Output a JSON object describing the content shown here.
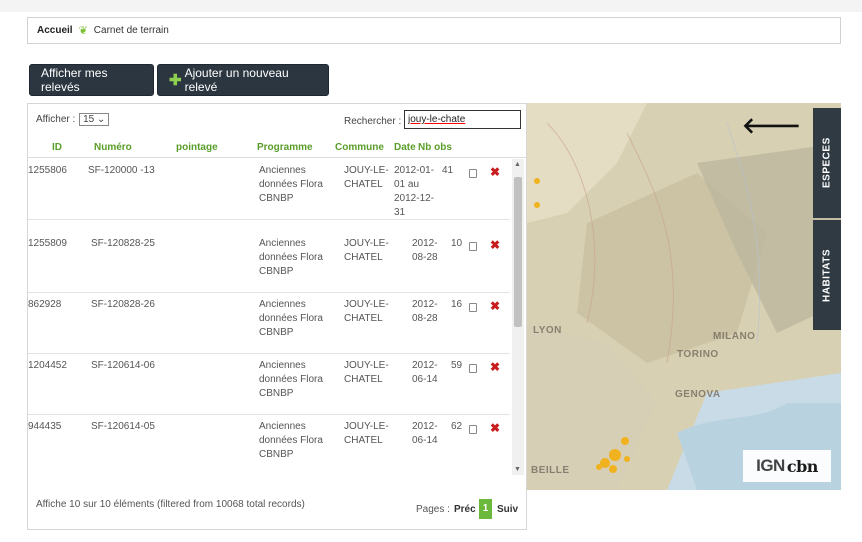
{
  "breadcrumb": {
    "home": "Accueil",
    "page": "Carnet de terrain"
  },
  "buttons": {
    "my_records": "Afficher mes relevés",
    "add_record": "Ajouter un nouveau relevé"
  },
  "controls": {
    "show_label": "Afficher :",
    "page_size": "15",
    "search_label": "Rechercher :",
    "search_value": "jouy-le-chate"
  },
  "columns": [
    "ID",
    "Numéro",
    "pointage",
    "Programme",
    "Commune",
    "Date",
    "Nb obs"
  ],
  "rows": [
    {
      "id": "1255806",
      "numero": "SF-120000 -13",
      "programme": [
        "Anciennes",
        "données Flora",
        "CBNBP"
      ],
      "commune": [
        "JOUY-LE-",
        "CHATEL"
      ],
      "date": [
        "2012-01-",
        "01 au",
        "2012-12-",
        "31"
      ],
      "nb_obs": "41"
    },
    {
      "id": "1255809",
      "numero": "SF-120828-25",
      "programme": [
        "Anciennes",
        "données Flora",
        "CBNBP"
      ],
      "commune": [
        "JOUY-LE-",
        "CHATEL"
      ],
      "date": [
        "2012-",
        "08-28"
      ],
      "nb_obs": "10"
    },
    {
      "id": "862928",
      "numero": "SF-120828-26",
      "programme": [
        "Anciennes",
        "données Flora",
        "CBNBP"
      ],
      "commune": [
        "JOUY-LE-",
        "CHATEL"
      ],
      "date": [
        "2012-",
        "08-28"
      ],
      "nb_obs": "16"
    },
    {
      "id": "1204452",
      "numero": "SF-120614-06",
      "programme": [
        "Anciennes",
        "données Flora",
        "CBNBP"
      ],
      "commune": [
        "JOUY-LE-",
        "CHATEL"
      ],
      "date": [
        "2012-",
        "06-14"
      ],
      "nb_obs": "59"
    },
    {
      "id": "944435",
      "numero": "SF-120614-05",
      "programme": [
        "Anciennes",
        "données Flora",
        "CBNBP"
      ],
      "commune": [
        "JOUY-LE-",
        "CHATEL"
      ],
      "date": [
        "2012-",
        "06-14"
      ],
      "nb_obs": "62"
    }
  ],
  "footer": {
    "info": "Affiche 10 sur 10 éléments (filtered from 10068 total records)",
    "pages_label": "Pages :",
    "prev": "Préc",
    "current_page": "1",
    "next": "Suiv"
  },
  "map": {
    "tabs": {
      "species": "ESPECES",
      "habitats": "HABITATS"
    },
    "place_labels": [
      "LYON",
      "TORINO",
      "MILANO",
      "GENOVA",
      "BEILLE"
    ],
    "logo_left": "IGN",
    "logo_right": "cbn"
  },
  "icons": {
    "breadcrumb_leaf": "leaf-icon",
    "add": "plus-icon",
    "back": "arrow-left-icon",
    "delete": "delete-cross-icon",
    "select": "checkbox-icon"
  },
  "colors": {
    "header_green": "#5a9e2a",
    "button_dark": "#2b3640",
    "delete_red": "#c81d1d",
    "page_green": "#6ab93c"
  }
}
